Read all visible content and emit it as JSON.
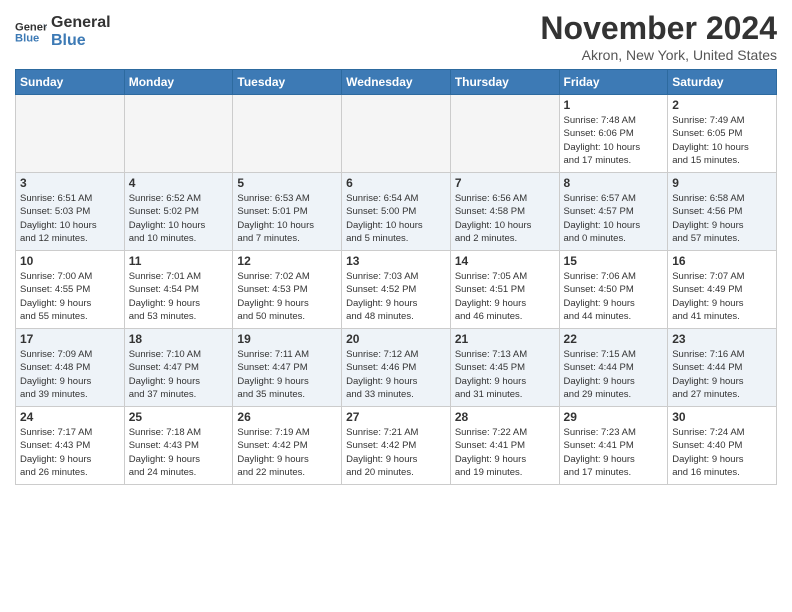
{
  "logo": {
    "text_line1": "General",
    "text_line2": "Blue"
  },
  "header": {
    "month": "November 2024",
    "location": "Akron, New York, United States"
  },
  "days_of_week": [
    "Sunday",
    "Monday",
    "Tuesday",
    "Wednesday",
    "Thursday",
    "Friday",
    "Saturday"
  ],
  "weeks": [
    {
      "cells": [
        {
          "day": "",
          "empty": true
        },
        {
          "day": "",
          "empty": true
        },
        {
          "day": "",
          "empty": true
        },
        {
          "day": "",
          "empty": true
        },
        {
          "day": "",
          "empty": true
        },
        {
          "day": "1",
          "info": "Sunrise: 7:48 AM\nSunset: 6:06 PM\nDaylight: 10 hours\nand 17 minutes."
        },
        {
          "day": "2",
          "info": "Sunrise: 7:49 AM\nSunset: 6:05 PM\nDaylight: 10 hours\nand 15 minutes."
        }
      ]
    },
    {
      "alt": true,
      "cells": [
        {
          "day": "3",
          "info": "Sunrise: 6:51 AM\nSunset: 5:03 PM\nDaylight: 10 hours\nand 12 minutes."
        },
        {
          "day": "4",
          "info": "Sunrise: 6:52 AM\nSunset: 5:02 PM\nDaylight: 10 hours\nand 10 minutes."
        },
        {
          "day": "5",
          "info": "Sunrise: 6:53 AM\nSunset: 5:01 PM\nDaylight: 10 hours\nand 7 minutes."
        },
        {
          "day": "6",
          "info": "Sunrise: 6:54 AM\nSunset: 5:00 PM\nDaylight: 10 hours\nand 5 minutes."
        },
        {
          "day": "7",
          "info": "Sunrise: 6:56 AM\nSunset: 4:58 PM\nDaylight: 10 hours\nand 2 minutes."
        },
        {
          "day": "8",
          "info": "Sunrise: 6:57 AM\nSunset: 4:57 PM\nDaylight: 10 hours\nand 0 minutes."
        },
        {
          "day": "9",
          "info": "Sunrise: 6:58 AM\nSunset: 4:56 PM\nDaylight: 9 hours\nand 57 minutes."
        }
      ]
    },
    {
      "cells": [
        {
          "day": "10",
          "info": "Sunrise: 7:00 AM\nSunset: 4:55 PM\nDaylight: 9 hours\nand 55 minutes."
        },
        {
          "day": "11",
          "info": "Sunrise: 7:01 AM\nSunset: 4:54 PM\nDaylight: 9 hours\nand 53 minutes."
        },
        {
          "day": "12",
          "info": "Sunrise: 7:02 AM\nSunset: 4:53 PM\nDaylight: 9 hours\nand 50 minutes."
        },
        {
          "day": "13",
          "info": "Sunrise: 7:03 AM\nSunset: 4:52 PM\nDaylight: 9 hours\nand 48 minutes."
        },
        {
          "day": "14",
          "info": "Sunrise: 7:05 AM\nSunset: 4:51 PM\nDaylight: 9 hours\nand 46 minutes."
        },
        {
          "day": "15",
          "info": "Sunrise: 7:06 AM\nSunset: 4:50 PM\nDaylight: 9 hours\nand 44 minutes."
        },
        {
          "day": "16",
          "info": "Sunrise: 7:07 AM\nSunset: 4:49 PM\nDaylight: 9 hours\nand 41 minutes."
        }
      ]
    },
    {
      "alt": true,
      "cells": [
        {
          "day": "17",
          "info": "Sunrise: 7:09 AM\nSunset: 4:48 PM\nDaylight: 9 hours\nand 39 minutes."
        },
        {
          "day": "18",
          "info": "Sunrise: 7:10 AM\nSunset: 4:47 PM\nDaylight: 9 hours\nand 37 minutes."
        },
        {
          "day": "19",
          "info": "Sunrise: 7:11 AM\nSunset: 4:47 PM\nDaylight: 9 hours\nand 35 minutes."
        },
        {
          "day": "20",
          "info": "Sunrise: 7:12 AM\nSunset: 4:46 PM\nDaylight: 9 hours\nand 33 minutes."
        },
        {
          "day": "21",
          "info": "Sunrise: 7:13 AM\nSunset: 4:45 PM\nDaylight: 9 hours\nand 31 minutes."
        },
        {
          "day": "22",
          "info": "Sunrise: 7:15 AM\nSunset: 4:44 PM\nDaylight: 9 hours\nand 29 minutes."
        },
        {
          "day": "23",
          "info": "Sunrise: 7:16 AM\nSunset: 4:44 PM\nDaylight: 9 hours\nand 27 minutes."
        }
      ]
    },
    {
      "cells": [
        {
          "day": "24",
          "info": "Sunrise: 7:17 AM\nSunset: 4:43 PM\nDaylight: 9 hours\nand 26 minutes."
        },
        {
          "day": "25",
          "info": "Sunrise: 7:18 AM\nSunset: 4:43 PM\nDaylight: 9 hours\nand 24 minutes."
        },
        {
          "day": "26",
          "info": "Sunrise: 7:19 AM\nSunset: 4:42 PM\nDaylight: 9 hours\nand 22 minutes."
        },
        {
          "day": "27",
          "info": "Sunrise: 7:21 AM\nSunset: 4:42 PM\nDaylight: 9 hours\nand 20 minutes."
        },
        {
          "day": "28",
          "info": "Sunrise: 7:22 AM\nSunset: 4:41 PM\nDaylight: 9 hours\nand 19 minutes."
        },
        {
          "day": "29",
          "info": "Sunrise: 7:23 AM\nSunset: 4:41 PM\nDaylight: 9 hours\nand 17 minutes."
        },
        {
          "day": "30",
          "info": "Sunrise: 7:24 AM\nSunset: 4:40 PM\nDaylight: 9 hours\nand 16 minutes."
        }
      ]
    }
  ]
}
